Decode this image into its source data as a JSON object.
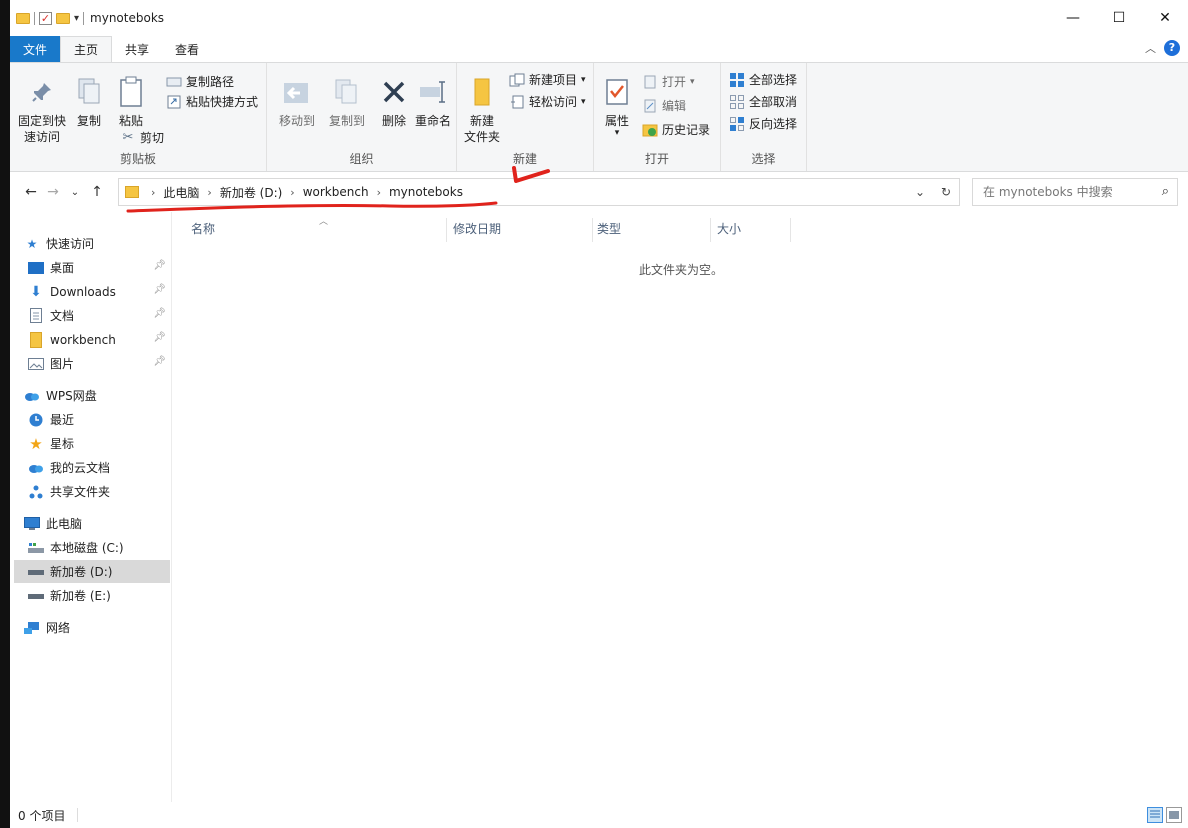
{
  "window": {
    "title": "mynoteboks",
    "controls": {
      "minimize": "—",
      "maximize": "☐",
      "close": "✕"
    }
  },
  "ribbon_tabs": [
    {
      "label": "文件"
    },
    {
      "label": "主页"
    },
    {
      "label": "共享"
    },
    {
      "label": "查看"
    }
  ],
  "ribbon": {
    "clipboard": {
      "group_label": "剪贴板",
      "pin_quick_access": "固定到快速访问",
      "pin_line1": "固定到快",
      "pin_line2": "速访问",
      "copy": "复制",
      "paste": "粘贴",
      "copy_path": "复制路径",
      "paste_shortcut": "粘贴快捷方式",
      "cut": "剪切"
    },
    "organize": {
      "group_label": "组织",
      "move_to": "移动到",
      "copy_to": "复制到",
      "delete": "删除",
      "rename": "重命名"
    },
    "new": {
      "group_label": "新建",
      "new_folder_line1": "新建",
      "new_folder_line2": "文件夹",
      "new_item": "新建项目",
      "easy_access": "轻松访问"
    },
    "open": {
      "group_label": "打开",
      "properties": "属性",
      "open": "打开",
      "edit": "编辑",
      "history": "历史记录"
    },
    "select": {
      "group_label": "选择",
      "select_all": "全部选择",
      "select_none": "全部取消",
      "invert": "反向选择"
    }
  },
  "address": {
    "crumbs": [
      "此电脑",
      "新加卷 (D:)",
      "workbench",
      "mynoteboks"
    ]
  },
  "search": {
    "placeholder": "在 mynoteboks 中搜索"
  },
  "nav": {
    "quick_access": "快速访问",
    "desktop": "桌面",
    "downloads": "Downloads",
    "documents": "文档",
    "workbench": "workbench",
    "pictures": "图片",
    "wps_cloud": "WPS网盘",
    "recent": "最近",
    "starred": "星标",
    "my_cloud_docs": "我的云文档",
    "shared_folder": "共享文件夹",
    "this_pc": "此电脑",
    "local_c": "本地磁盘 (C:)",
    "vol_d": "新加卷 (D:)",
    "vol_e": "新加卷 (E:)",
    "network": "网络"
  },
  "columns": {
    "name": "名称",
    "modified": "修改日期",
    "type": "类型",
    "size": "大小"
  },
  "content": {
    "empty_message": "此文件夹为空。"
  },
  "status": {
    "item_count": "0 个项目"
  }
}
